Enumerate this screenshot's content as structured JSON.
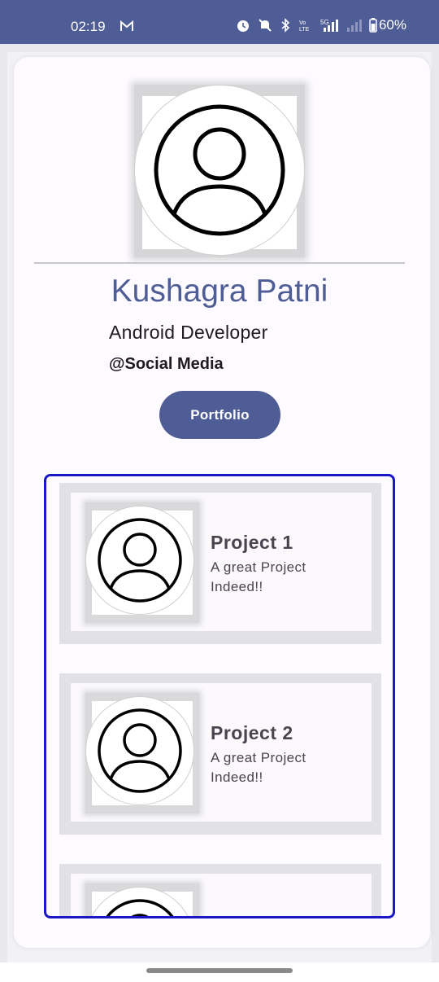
{
  "status_bar": {
    "time": "02:19",
    "battery": "60%",
    "icons": [
      "mail-icon",
      "alarm-icon",
      "mute-icon",
      "bluetooth-icon",
      "volte-icon",
      "signal-5g-icon",
      "signal-icon",
      "battery-icon"
    ]
  },
  "profile": {
    "avatar_icon": "account-circle-icon",
    "name": "Kushagra Patni",
    "title": "Android Developer",
    "social": "@Social Media",
    "portfolio_label": "Portfolio"
  },
  "projects": [
    {
      "title": "Project 1",
      "description": "A great Project Indeed!!"
    },
    {
      "title": "Project 2",
      "description": "A great Project Indeed!!"
    },
    {
      "title": "",
      "description": ""
    }
  ],
  "colors": {
    "primary": "#4f5d96",
    "list_border": "#1a17c4"
  }
}
